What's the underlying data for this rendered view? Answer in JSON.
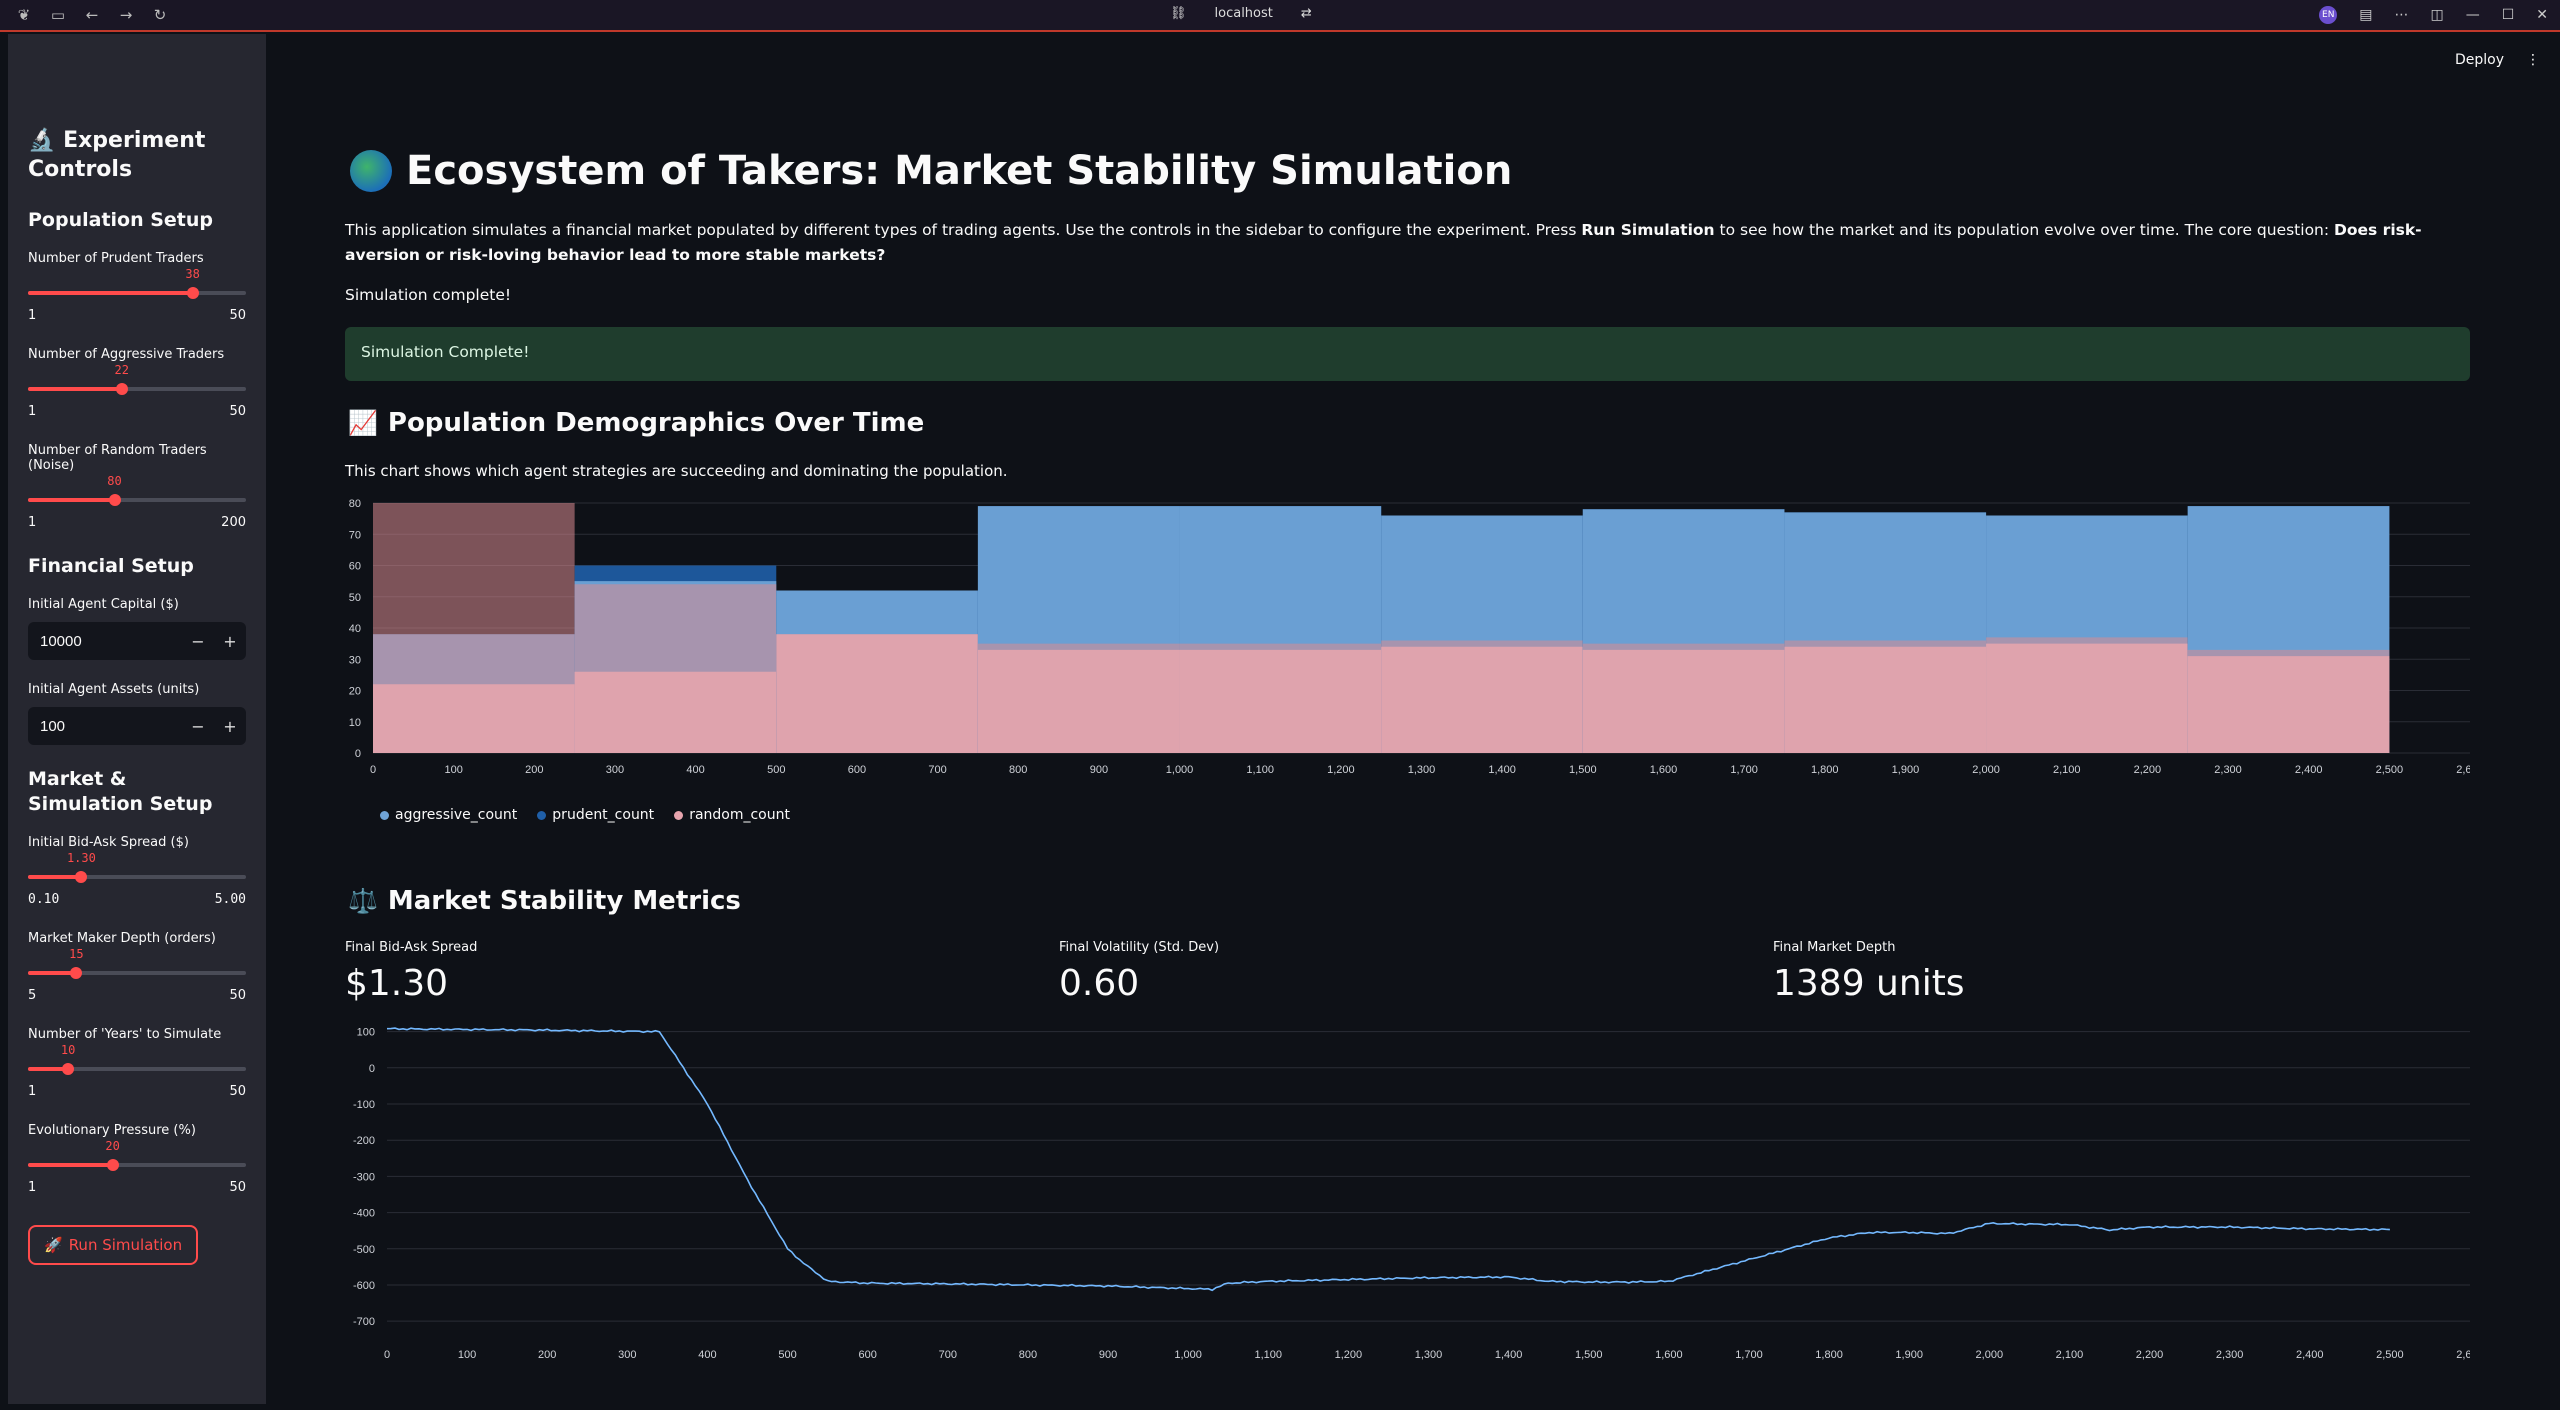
{
  "browser": {
    "url": "localhost",
    "badge": "EN"
  },
  "header": {
    "deploy_label": "Deploy"
  },
  "sidebar": {
    "title_icon": "microscope-icon",
    "title": "Experiment Controls",
    "population_heading": "Population Setup",
    "sliders_population": [
      {
        "label": "Number of Prudent Traders",
        "value": "38",
        "min": "1",
        "max": "50",
        "fraction": 0.755
      },
      {
        "label": "Number of Aggressive Traders",
        "value": "22",
        "min": "1",
        "max": "50",
        "fraction": 0.43
      },
      {
        "label": "Number of Random Traders (Noise)",
        "value": "80",
        "min": "1",
        "max": "200",
        "fraction": 0.397
      }
    ],
    "financial_heading": "Financial Setup",
    "capital_label": "Initial Agent Capital ($)",
    "capital_value": "10000",
    "assets_label": "Initial Agent Assets (units)",
    "assets_value": "100",
    "market_heading": "Market & Simulation Setup",
    "sliders_market": [
      {
        "label": "Initial Bid-Ask Spread ($)",
        "value": "1.30",
        "min": "0.10",
        "max": "5.00",
        "fraction": 0.245,
        "mono": true
      },
      {
        "label": "Market Maker Depth (orders)",
        "value": "15",
        "min": "5",
        "max": "50",
        "fraction": 0.222
      },
      {
        "label": "Number of 'Years' to Simulate",
        "value": "10",
        "min": "1",
        "max": "50",
        "fraction": 0.184
      },
      {
        "label": "Evolutionary Pressure (%)",
        "value": "20",
        "min": "1",
        "max": "50",
        "fraction": 0.388
      }
    ],
    "run_button": "Run Simulation"
  },
  "main": {
    "title": "Ecosystem of Takers: Market Stability Simulation",
    "intro_1": "This application simulates a financial market populated by different types of trading agents. Use the controls in the sidebar to configure the experiment. Press ",
    "intro_bold_1": "Run Simulation",
    "intro_2": " to see how the market and its population evolve over time. The core question: ",
    "intro_bold_2": "Does risk-aversion or risk-loving behavior lead to more stable markets?",
    "status_text": "Simulation complete!",
    "success_message": "Simulation Complete!",
    "demographics_heading": "Population Demographics Over Time",
    "demographics_caption": "This chart shows which agent strategies are succeeding and dominating the population.",
    "stability_heading": "Market Stability Metrics",
    "metrics": [
      {
        "label": "Final Bid-Ask Spread",
        "value": "$1.30"
      },
      {
        "label": "Final Volatility (Std. Dev)",
        "value": "0.60"
      },
      {
        "label": "Final Market Depth",
        "value": "1389 units"
      }
    ]
  },
  "chart_data": [
    {
      "type": "area",
      "title": "",
      "x_ticks": [
        "0",
        "100",
        "200",
        "300",
        "400",
        "500",
        "600",
        "700",
        "800",
        "900",
        "1,000",
        "1,100",
        "1,200",
        "1,300",
        "1,400",
        "1,500",
        "1,600",
        "1,700",
        "1,800",
        "1,900",
        "2,000",
        "2,100",
        "2,200",
        "2,300",
        "2,400",
        "2,500",
        "2,600"
      ],
      "y_ticks": [
        "0",
        "10",
        "20",
        "30",
        "40",
        "50",
        "60",
        "70",
        "80"
      ],
      "xlim": [
        0,
        2600
      ],
      "ylim": [
        0,
        80
      ],
      "segments_x": [
        0,
        250,
        500,
        750,
        1000,
        1250,
        1500,
        1750,
        2000,
        2250,
        2500
      ],
      "series": [
        {
          "name": "aggressive_count",
          "color": "#6fa3d6",
          "values": [
            38,
            55,
            52,
            79,
            79,
            76,
            78,
            77,
            76,
            79
          ]
        },
        {
          "name": "prudent_count",
          "color": "#1f5fa8",
          "values": [
            38,
            60,
            52,
            79,
            79,
            76,
            78,
            77,
            76,
            79
          ]
        },
        {
          "name": "random_count",
          "color": "#e6a4ad",
          "values": [
            80,
            54,
            38,
            35,
            35,
            36,
            35,
            36,
            37,
            33
          ]
        }
      ],
      "random_lower": [
        22,
        26,
        38,
        33,
        33,
        34,
        33,
        34,
        35,
        31
      ],
      "legend_placement": "bottom-left"
    },
    {
      "type": "line",
      "title": "",
      "x_ticks": [
        "0",
        "100",
        "200",
        "300",
        "400",
        "500",
        "600",
        "700",
        "800",
        "900",
        "1,000",
        "1,100",
        "1,200",
        "1,300",
        "1,400",
        "1,500",
        "1,600",
        "1,700",
        "1,800",
        "1,900",
        "2,000",
        "2,100",
        "2,200",
        "2,300",
        "2,400",
        "2,500",
        "2,600"
      ],
      "y_ticks": [
        "100",
        "0",
        "-100",
        "-200",
        "-300",
        "-400",
        "-500",
        "-600",
        "-700"
      ],
      "xlim": [
        0,
        2600
      ],
      "ylim": [
        -730,
        110
      ],
      "x": [
        0,
        100,
        200,
        300,
        340,
        400,
        450,
        500,
        520,
        550,
        600,
        700,
        800,
        900,
        1000,
        1030,
        1050,
        1100,
        1200,
        1300,
        1400,
        1450,
        1500,
        1550,
        1600,
        1700,
        1800,
        1850,
        1900,
        1950,
        2000,
        2050,
        2100,
        2150,
        2200,
        2300,
        2400,
        2500
      ],
      "values": [
        108,
        106,
        104,
        101,
        100,
        -100,
        -310,
        -500,
        -540,
        -590,
        -595,
        -597,
        -600,
        -603,
        -610,
        -612,
        -595,
        -590,
        -585,
        -580,
        -578,
        -590,
        -592,
        -592,
        -590,
        -530,
        -470,
        -455,
        -455,
        -458,
        -430,
        -432,
        -433,
        -448,
        -440,
        -440,
        -445,
        -447
      ],
      "color": "#74b9ff"
    }
  ]
}
